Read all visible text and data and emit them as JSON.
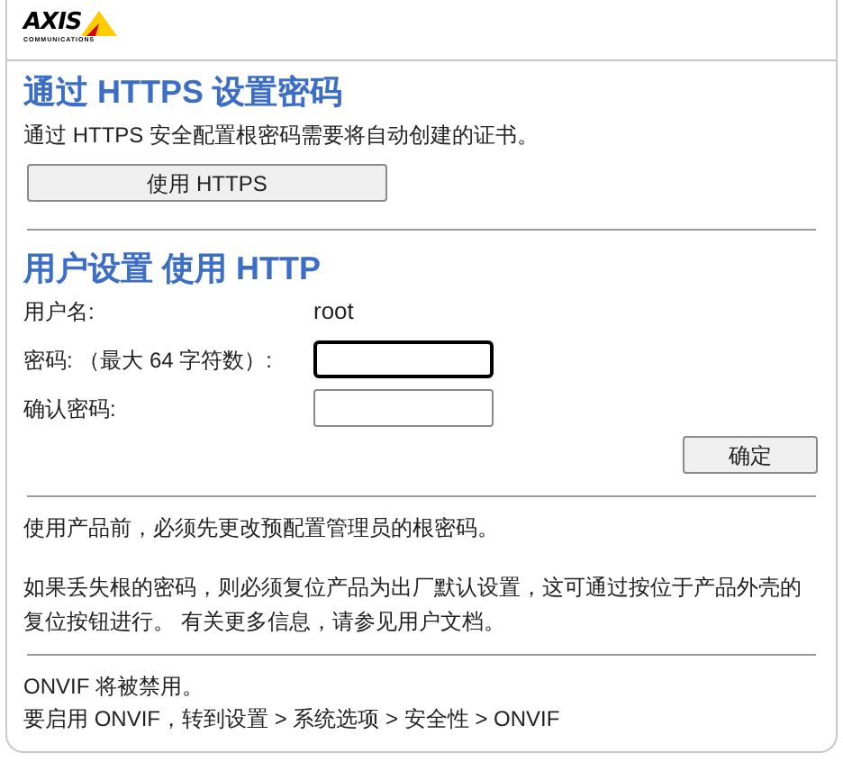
{
  "logo": {
    "name": "AXIS",
    "tagline": "COMMUNICATIONS"
  },
  "https_section": {
    "title": "通过 HTTPS 设置密码",
    "description": "通过 HTTPS 安全配置根密码需要将自动创建的证书。",
    "button": "使用 HTTPS"
  },
  "http_section": {
    "title": "用户设置 使用 HTTP",
    "fields": [
      {
        "kind": "text",
        "label": "用户名:",
        "value": "root"
      },
      {
        "kind": "input",
        "label": "密码: （最大 64 字符数）:",
        "focused": true
      },
      {
        "kind": "input",
        "label": "确认密码:",
        "focused": false
      }
    ],
    "button": "确定"
  },
  "notes": [
    "使用产品前，必须先更改预配置管理员的根密码。",
    "如果丢失根的密码，则必须复位产品为出厂默认设置，这可通过按位于产品外壳的复位按钮进行。 有关更多信息，请参见用户文档。"
  ],
  "onvif": [
    "ONVIF 将被禁用。",
    "要启用 ONVIF，转到设置 > 系统选项 > 安全性 > ONVIF"
  ]
}
